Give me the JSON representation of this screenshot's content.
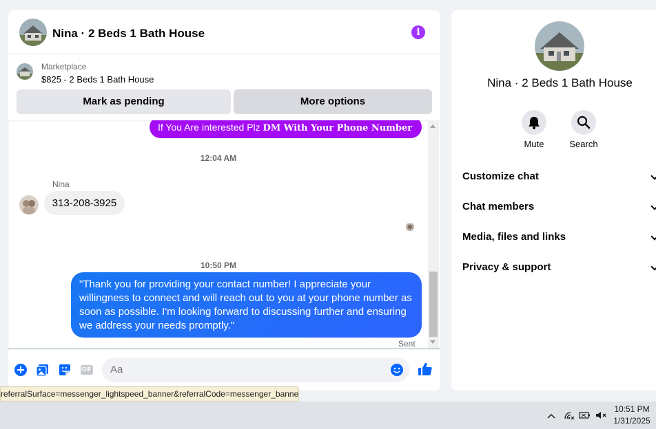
{
  "chat": {
    "title": "Nina · 2 Beds 1 Bath House",
    "marketplace_label": "Marketplace",
    "listing": "$825 - 2 Beds 1 Bath House",
    "mark_pending": "Mark as pending",
    "more_options": "More options"
  },
  "messages": {
    "purple_text": "If You Are interested Plz ",
    "purple_bold": "DM With Your Phone Number",
    "time1": "12:04 AM",
    "sender": "Nina",
    "phone": "313-208-3925",
    "time2": "10:50 PM",
    "reply": "\"Thank you for providing your contact number! I appreciate your willingness to connect and will reach out to you at your phone number as soon as possible. I'm looking forward to discussing further and ensuring we address your needs promptly.\"",
    "status": "Sent"
  },
  "composer": {
    "placeholder": "Aa",
    "icons": [
      "plus-icon",
      "photo-icon",
      "sticker-icon",
      "gif-icon",
      "emoji-icon",
      "like-icon"
    ],
    "gif_label": "GIF"
  },
  "side": {
    "name": "Nina · 2 Beds 1 Bath House",
    "mute": "Mute",
    "search": "Search",
    "menu": [
      "Customize chat",
      "Chat members",
      "Media, files and links",
      "Privacy & support"
    ]
  },
  "status_url": "referralSurface=messenger_lightspeed_banner&referralCode=messenger_banner",
  "taskbar": {
    "time": "10:51 PM",
    "date": "1/31/2025"
  },
  "colors": {
    "accent_purple": "#a40cf5",
    "accent_blue": "#1877f2"
  }
}
